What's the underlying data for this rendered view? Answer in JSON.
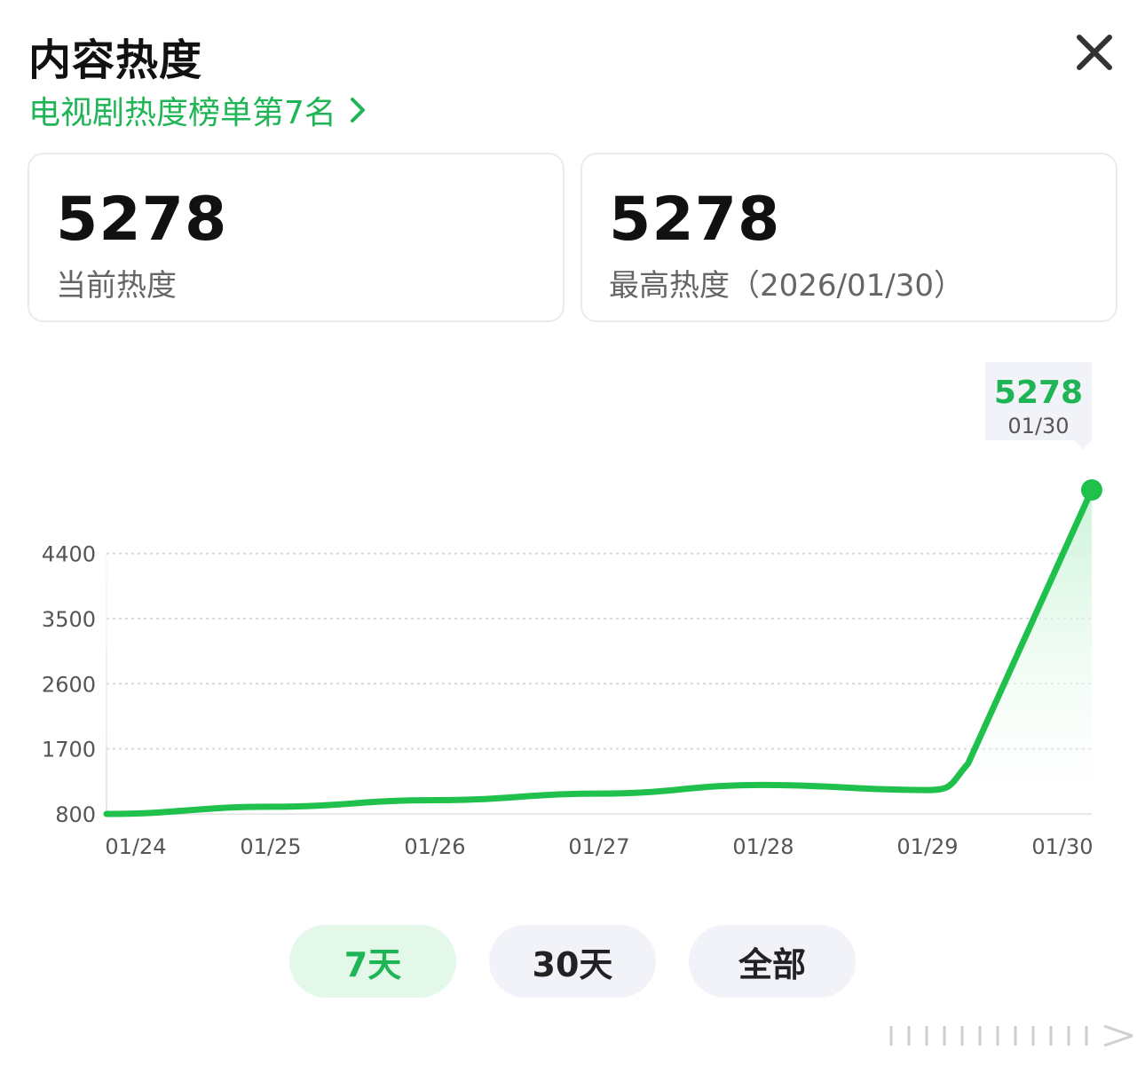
{
  "header": {
    "title": "内容热度",
    "rank_label": "电视剧热度榜单第7名"
  },
  "stats": {
    "current": {
      "value": "5278",
      "label": "当前热度"
    },
    "highest": {
      "value": "5278",
      "label": "最高热度（2026/01/30）"
    }
  },
  "tooltip": {
    "value": "5278",
    "date": "01/30"
  },
  "chart_data": {
    "type": "area",
    "x": [
      "01/24",
      "01/25",
      "01/26",
      "01/27",
      "01/28",
      "01/29",
      "01/30"
    ],
    "y_ticks": [
      "4400",
      "3500",
      "2600",
      "1700",
      "800"
    ],
    "ylim": [
      800,
      5278
    ],
    "series": [
      {
        "values": [
          800,
          900,
          990,
          1080,
          1200,
          1130,
          5278
        ]
      }
    ],
    "grid": true,
    "colors": {
      "line": "#1fc04b",
      "fill_top": "#c8f3d6",
      "grid": "#d9d9d9"
    }
  },
  "range_tabs": [
    {
      "label": "7天",
      "active": true
    },
    {
      "label": "30天",
      "active": false
    },
    {
      "label": "全部",
      "active": false
    }
  ],
  "colors": {
    "accent": "#1fb556",
    "text": "#111111",
    "muted": "#666666"
  }
}
